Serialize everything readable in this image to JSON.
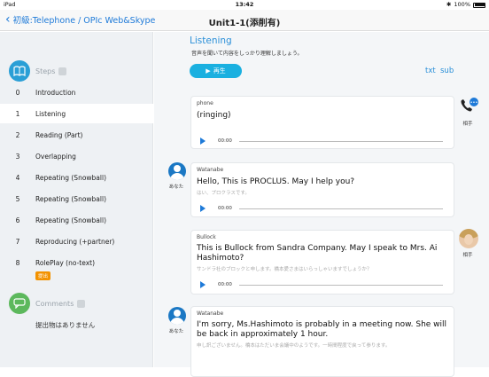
{
  "status": {
    "device": "iPad",
    "time": "13:42",
    "battery": "100%"
  },
  "nav": {
    "back_label": "初級:Telephone / OPIc Web&Skype",
    "title": "Unit1-1(添削有)"
  },
  "sidebar": {
    "steps_label": "Steps",
    "steps": [
      {
        "num": "0",
        "label": "Introduction"
      },
      {
        "num": "1",
        "label": "Listening"
      },
      {
        "num": "2",
        "label": "Reading (Part)"
      },
      {
        "num": "3",
        "label": "Overlapping"
      },
      {
        "num": "4",
        "label": "Repeating (Snowball)"
      },
      {
        "num": "5",
        "label": "Repeating (Snowball)"
      },
      {
        "num": "6",
        "label": "Repeating (Snowball)"
      },
      {
        "num": "7",
        "label": "Reproducing (+partner)"
      },
      {
        "num": "8",
        "label": "RolePlay (no-text)"
      }
    ],
    "step8_tag": "提出",
    "comments_label": "Comments",
    "comments_text": "提出物はありません"
  },
  "main": {
    "title": "Listening",
    "instruction": "音声を聞いて内容をしっかり理解しましょう。",
    "play_label": "再生",
    "txt_label": "txt",
    "sub_label": "sub",
    "cards": [
      {
        "speaker": "phone",
        "line": "(ringing)",
        "translation": "",
        "time": "00:00"
      },
      {
        "speaker": "Watanabe",
        "line": "Hello, This is PROCLUS. May I help you?",
        "translation": "はい、プロクラスです。",
        "time": "00:00"
      },
      {
        "speaker": "Bullock",
        "line": "This is Bullock from Sandra Company. May I speak to Mrs. Ai Hashimoto?",
        "translation": "サンドラ社のブロックと申します。橋本愛さまはいらっしゃいますでしょうか？",
        "time": "00:00"
      },
      {
        "speaker": "Watanabe",
        "line": "I'm sorry, Ms.Hashimoto is probably in a meeting now. She will be back in approximately 1 hour.",
        "translation": "申し訳ございません。橋本はただいま会議中のようです。一時間程度で戻って参ります。",
        "time": "00:00"
      }
    ],
    "partner_label": "相手",
    "self_label": "あなた"
  },
  "colors": {
    "accent": "#1ab0e0",
    "link": "#2a8fd8",
    "tag": "#f39200",
    "avatar": "#1b78c4"
  }
}
